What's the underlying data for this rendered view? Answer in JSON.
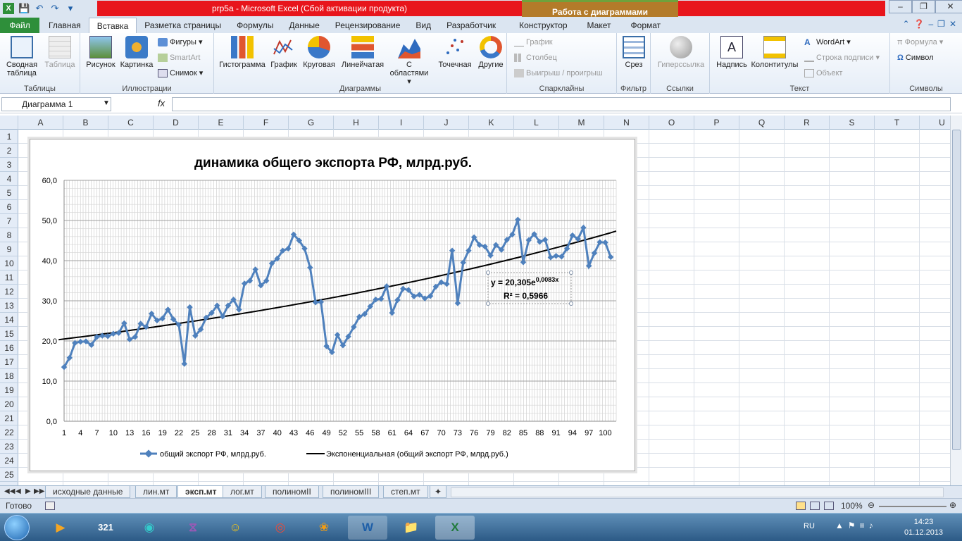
{
  "window": {
    "title": "prp5a  -  Microsoft Excel (Сбой активации продукта)",
    "context_title": "Работа с диаграммами"
  },
  "tabs": [
    "Файл",
    "Главная",
    "Вставка",
    "Разметка страницы",
    "Формулы",
    "Данные",
    "Рецензирование",
    "Вид",
    "Разработчик",
    "Конструктор",
    "Макет",
    "Формат"
  ],
  "ribbon": {
    "groups": {
      "tables": "Таблицы",
      "illustrations": "Иллюстрации",
      "charts": "Диаграммы",
      "sparklines": "Спарклайны",
      "filter": "Фильтр",
      "links": "Ссылки",
      "text": "Текст",
      "symbols": "Символы"
    },
    "pivot": "Сводная таблица",
    "table": "Таблица",
    "picture": "Рисунок",
    "clipart": "Картинка",
    "shapes": "Фигуры",
    "smartart": "SmartArt",
    "screenshot": "Снимок",
    "histogram": "Гистограмма",
    "line": "График",
    "pie": "Круговая",
    "bar": "Линейчатая",
    "area": "С областями",
    "scatter": "Точечная",
    "other": "Другие",
    "spark_line": "График",
    "spark_column": "Столбец",
    "spark_winloss": "Выигрыш / проигрыш",
    "slicer": "Срез",
    "hyperlink": "Гиперссылка",
    "textbox": "Надпись",
    "headerfooter": "Колонтитулы",
    "wordart": "WordArt",
    "signature": "Строка подписи",
    "object": "Объект",
    "equation": "Формула",
    "symbol": "Символ"
  },
  "formula_bar": {
    "name_box": "Диаграмма 1",
    "fx": "fx",
    "formula": ""
  },
  "columns": [
    "A",
    "B",
    "C",
    "D",
    "E",
    "F",
    "G",
    "H",
    "I",
    "J",
    "K",
    "L",
    "M",
    "N",
    "O",
    "P",
    "Q",
    "R",
    "S",
    "T",
    "U"
  ],
  "rows": [
    "1",
    "2",
    "3",
    "4",
    "5",
    "6",
    "7",
    "8",
    "9",
    "10",
    "11",
    "12",
    "13",
    "14",
    "15",
    "16",
    "17",
    "18",
    "19",
    "20",
    "21",
    "22",
    "23",
    "24",
    "25"
  ],
  "sheets": [
    "исходные данные",
    "лин.мт",
    "эксп.мт",
    "лог.мт",
    "полиномII",
    "полиномIII",
    "степ.мт"
  ],
  "active_sheet": "эксп.мт",
  "status": {
    "ready": "Готово",
    "zoom": "100%"
  },
  "taskbar": {
    "lang": "RU",
    "time": "14:23",
    "date": "01.12.2013"
  },
  "colors": {
    "series": "#4f81bd",
    "trend": "#000000",
    "excel_green": "#2e8f3a",
    "title_red": "#e8151c",
    "context": "#b37b2a"
  },
  "chart_data": {
    "type": "line",
    "title": "динамика общего экспорта РФ, млрд.руб.",
    "ylim": [
      0,
      60
    ],
    "yticks": [
      "0,0",
      "10,0",
      "20,0",
      "30,0",
      "40,0",
      "50,0",
      "60,0"
    ],
    "xlim": [
      1,
      102
    ],
    "xticks": [
      1,
      4,
      7,
      10,
      13,
      16,
      19,
      22,
      25,
      28,
      31,
      34,
      37,
      40,
      43,
      46,
      49,
      52,
      55,
      58,
      61,
      64,
      67,
      70,
      73,
      76,
      79,
      82,
      85,
      88,
      91,
      94,
      97,
      100
    ],
    "grid": true,
    "legend_position": "bottom",
    "series": [
      {
        "name": "общий экспорт РФ, млрд.руб.",
        "x": [
          1,
          2,
          3,
          4,
          5,
          6,
          7,
          8,
          9,
          10,
          11,
          12,
          13,
          14,
          15,
          16,
          17,
          18,
          19,
          20,
          21,
          22,
          23,
          24,
          25,
          26,
          27,
          28,
          29,
          30,
          31,
          32,
          33,
          34,
          35,
          36,
          37,
          38,
          39,
          40,
          41,
          42,
          43,
          44,
          45,
          46,
          47,
          48,
          49,
          50,
          51,
          52,
          53,
          54,
          55,
          56,
          57,
          58,
          59,
          60,
          61,
          62,
          63,
          64,
          65,
          66,
          67,
          68,
          69,
          70,
          71,
          72,
          73,
          74,
          75,
          76,
          77,
          78,
          79,
          80,
          81,
          82,
          83,
          84,
          85,
          86,
          87,
          88,
          89,
          90,
          91,
          92,
          93,
          94,
          95,
          96,
          97,
          98,
          99,
          100,
          101
        ],
        "values": [
          13.5,
          15.8,
          19.5,
          19.8,
          19.9,
          19.0,
          21.0,
          21.3,
          21.2,
          21.8,
          22.0,
          24.4,
          20.4,
          21.0,
          24.3,
          23.5,
          26.8,
          25.1,
          25.6,
          27.8,
          25.4,
          24.0,
          14.3,
          28.4,
          21.3,
          22.9,
          25.8,
          27.0,
          28.8,
          26.1,
          28.8,
          30.3,
          27.8,
          34.3,
          35.0,
          37.8,
          33.8,
          35.0,
          39.3,
          40.5,
          42.5,
          43.0,
          46.5,
          45.0,
          43.0,
          38.3,
          29.6,
          29.7,
          18.7,
          17.2,
          21.5,
          18.9,
          21.1,
          23.5,
          26.0,
          26.7,
          28.6,
          30.3,
          30.5,
          33.6,
          27.0,
          30.2,
          33.0,
          32.7,
          31.1,
          31.5,
          30.6,
          31.2,
          33.5,
          34.6,
          34.2,
          42.5,
          29.4,
          39.5,
          42.5,
          45.8,
          43.9,
          43.5,
          41.3,
          43.9,
          42.7,
          45.2,
          46.5,
          50.2,
          39.6,
          45.1,
          46.6,
          44.7,
          45.2,
          40.8,
          41.2,
          41.0,
          43.0,
          46.3,
          45.4,
          48.2,
          38.7,
          41.9,
          44.6,
          44.5,
          40.9
        ]
      },
      {
        "name": "Экспоненциальная (общий экспорт РФ, млрд.руб.)",
        "trend": {
          "a": 20.305,
          "b": 0.0083,
          "x_from": 0,
          "x_to": 102
        }
      }
    ],
    "annotation": {
      "equation": "y = 20,305e",
      "exponent": "0,0083x",
      "r2": "R² = 0,5966"
    }
  }
}
